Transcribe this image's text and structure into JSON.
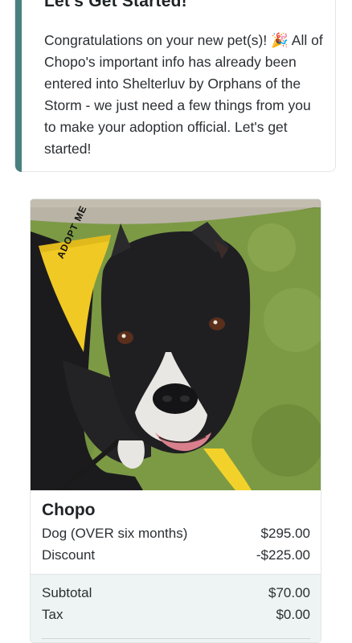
{
  "welcome": {
    "title": "Let's Get Started!",
    "message": "Congratulations on your new pet(s)! 🎉 All of Chopo's important info has already been entered into Shelterluv by Orphans of the Storm - we just need a few things from you to make your adoption official. Let's get started!"
  },
  "pet": {
    "photo_icon": "dog-photo",
    "bandana_text": "ADOPT ME",
    "name": "Chopo",
    "species_label": "Dog (OVER six months)",
    "species_price": "$295.00",
    "discount_label": "Discount",
    "discount_amount": "-$225.00"
  },
  "totals": {
    "subtotal_label": "Subtotal",
    "subtotal_amount": "$70.00",
    "tax_label": "Tax",
    "tax_amount": "$0.00"
  },
  "colors": {
    "accent": "#4a7f7f",
    "totals_bg": "#eef4f4"
  }
}
